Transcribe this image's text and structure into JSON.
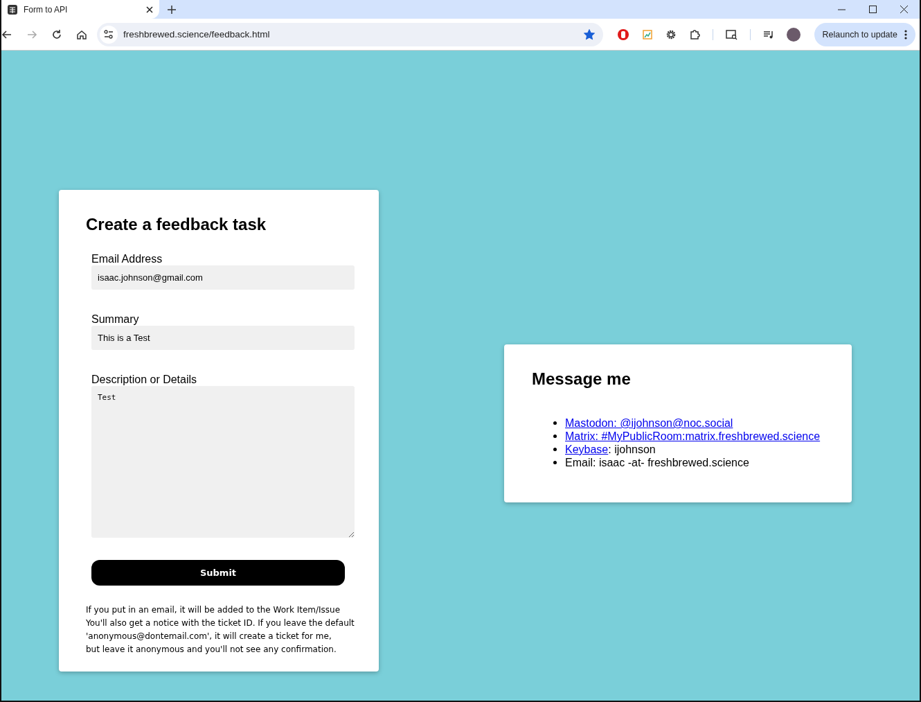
{
  "browser": {
    "tab_title": "Form to API",
    "url": "freshbrewed.science/feedback.html",
    "bookmarked": true,
    "update_button": "Relaunch to update"
  },
  "form": {
    "title": "Create a feedback task",
    "fields": [
      {
        "kind": "input",
        "label": "Email Address",
        "value": "isaac.johnson@gmail.com"
      },
      {
        "kind": "input",
        "label": "Summary",
        "value": "This is a Test"
      },
      {
        "kind": "textarea",
        "label": "Description or Details",
        "value": "Test"
      }
    ],
    "submit": "Submit",
    "note_lines": [
      "If you put in an email, it will be added to the Work Item/Issue",
      "You'll also get a notice with the ticket ID. If you leave the default",
      "'anonymous@dontemail.com', it will create a ticket for me,",
      "but leave it anonymous and you'll not see any confirmation."
    ]
  },
  "contact": {
    "title": "Message me",
    "items": [
      {
        "kind": "link",
        "link": "Mastodon: @ijohnson@noc.social"
      },
      {
        "kind": "link",
        "link": "Matrix: #MyPublicRoom:matrix.freshbrewed.science"
      },
      {
        "kind": "link",
        "link": "Keybase",
        "rest": ": ijohnson"
      },
      {
        "kind": "text",
        "rest": "Email: isaac -at- freshbrewed.science"
      }
    ]
  }
}
